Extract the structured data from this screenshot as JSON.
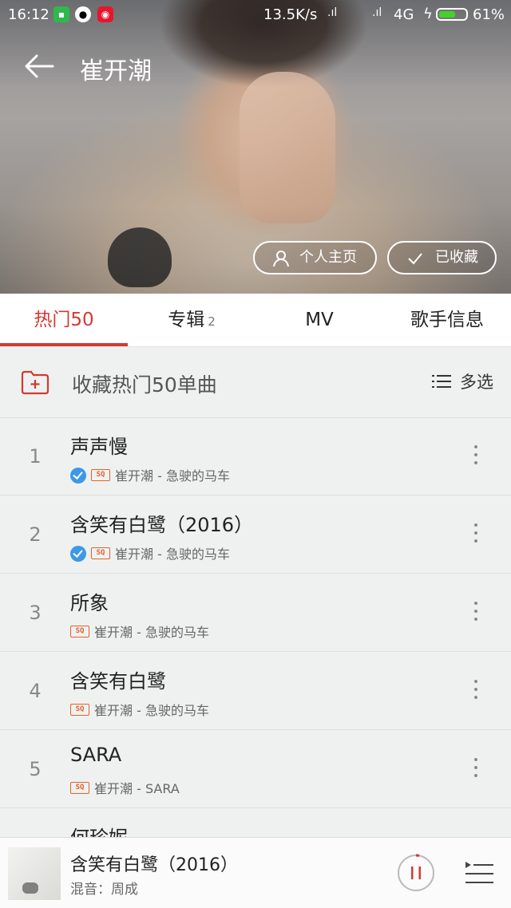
{
  "status_bar": {
    "time": "16:12",
    "speed": "13.5K/s",
    "network": "4G",
    "battery": "61%",
    "battery_level": 0.61
  },
  "header": {
    "title": "崔开潮",
    "home_label": "个人主页",
    "fav_label": "已收藏"
  },
  "tabs": [
    {
      "label": "热门50",
      "count": ""
    },
    {
      "label": "专辑",
      "count": "2"
    },
    {
      "label": "MV",
      "count": ""
    },
    {
      "label": "歌手信息",
      "count": ""
    }
  ],
  "collect": {
    "label": "收藏热门50单曲",
    "multi_select": "多选"
  },
  "songs": [
    {
      "index": "1",
      "title": "声声慢",
      "meta": "崔开潮 - 急驶的马车",
      "downloaded": true
    },
    {
      "index": "2",
      "title": "含笑有白鹭（2016）",
      "meta": "崔开潮 - 急驶的马车",
      "downloaded": true
    },
    {
      "index": "3",
      "title": "所象",
      "meta": "崔开潮 - 急驶的马车",
      "downloaded": false
    },
    {
      "index": "4",
      "title": "含笑有白鹭",
      "meta": "崔开潮 - 急驶的马车",
      "downloaded": false
    },
    {
      "index": "5",
      "title": "SARA",
      "meta": "崔开潮 - SARA",
      "downloaded": false
    }
  ],
  "partial_song": "何珍妮",
  "player": {
    "title": "含笑有白鹭（2016）",
    "subtitle": "混音：周成"
  },
  "colors": {
    "accent": "#d33a31",
    "verified": "#3c99e6",
    "sq_badge": "#e2612a"
  }
}
